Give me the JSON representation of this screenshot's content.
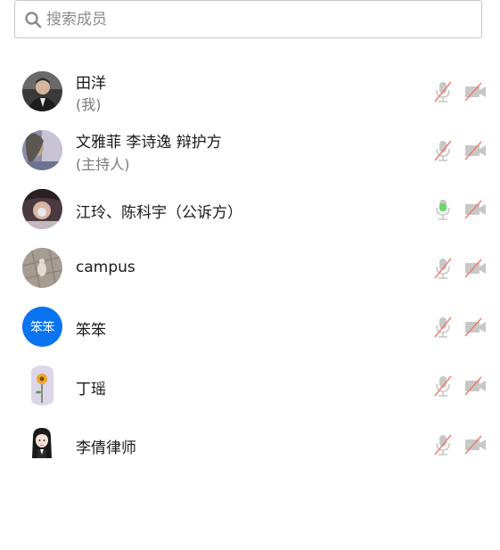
{
  "search": {
    "placeholder": "搜索成员",
    "value": ""
  },
  "members": [
    {
      "name": "田洋",
      "note": "(我)",
      "mic": "muted",
      "camera": "off"
    },
    {
      "name": "文雅菲 李诗逸 辩护方",
      "note": "(主持人)",
      "mic": "muted",
      "camera": "off"
    },
    {
      "name": "江玲、陈科宇（公诉方）",
      "note": "",
      "mic": "on",
      "camera": "off"
    },
    {
      "name": "campus",
      "note": "",
      "mic": "muted",
      "camera": "off"
    },
    {
      "name": "笨笨",
      "note": "",
      "avatar_text": "笨笨",
      "mic": "muted",
      "camera": "off"
    },
    {
      "name": "丁瑶",
      "note": "",
      "mic": "muted",
      "camera": "off"
    },
    {
      "name": "李倩律师",
      "note": "",
      "mic": "muted",
      "camera": "off"
    }
  ],
  "colors": {
    "muted_slash": "#f07a6a",
    "icon_gray": "#c8c8c8",
    "mic_active": "#6ad96a",
    "avatar_blue": "#0a73f0"
  }
}
